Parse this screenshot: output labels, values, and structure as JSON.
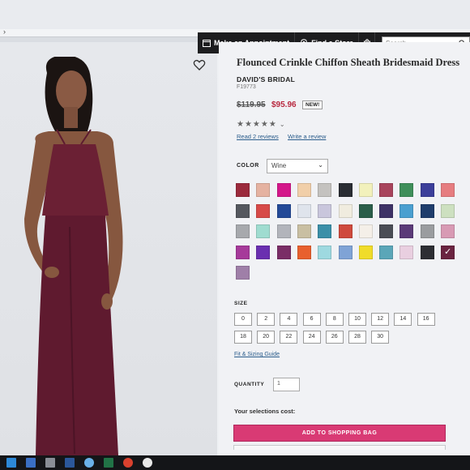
{
  "header": {
    "appointment_label": "Make an Appointment",
    "store_label": "Find a Store",
    "search_placeholder": "Search"
  },
  "product": {
    "title": "Flounced Crinkle Chiffon Sheath Bridesmaid Dress",
    "brand": "DAVID'S BRIDAL",
    "sku": "F19773",
    "old_price": "$119.95",
    "new_price": "$95.96",
    "badge": "NEW!",
    "rating_stars": "★★★★★",
    "rating_chevron": "⌄",
    "reviews_link": "Read 2 reviews",
    "write_review_link": "Write a review"
  },
  "color": {
    "label": "COLOR",
    "selected": "Wine",
    "swatches": [
      "#9b2a3c",
      "#e5b2a1",
      "#d4178a",
      "#f1cfa9",
      "#c4c2bf",
      "#2a2d33",
      "#f2f1bc",
      "#a8445c",
      "#3f8f5a",
      "#3c3f9a",
      "#e67d80",
      "#55585e",
      "#d74a48",
      "#244a98",
      "#dfe4ec",
      "#c9c6dc",
      "#f0ecdf",
      "#2b5e4a",
      "#3e3266",
      "#4a9fd0",
      "#1f3d6c",
      "#cde0c0",
      "#a7a9ad",
      "#9fdcd0",
      "#b2b4bb",
      "#c9bfa2",
      "#3b8fa8",
      "#cf4a3d",
      "#f4efe8",
      "#4a4d55",
      "#5b3a78",
      "#9a9c9f",
      "#d89ab4",
      "#a63a9a",
      "#6a2fb0",
      "#7a2d66",
      "#e8602e",
      "#9ed9e0",
      "#7fa3d6",
      "#f0dc2a",
      "#5aa6b8",
      "#e9cfe0",
      "#2d2e33",
      "#6a2340",
      "#9f7fa8"
    ],
    "selected_index": 43
  },
  "size": {
    "label": "SIZE",
    "options": [
      "0",
      "2",
      "4",
      "6",
      "8",
      "10",
      "12",
      "14",
      "16",
      "18",
      "20",
      "22",
      "24",
      "26",
      "28",
      "30"
    ],
    "fit_link": "Fit & Sizing Guide"
  },
  "quantity": {
    "label": "QUANTITY",
    "value": "1"
  },
  "cost_label": "Your selections cost:",
  "add_button": "ADD TO SHOPPING BAG"
}
